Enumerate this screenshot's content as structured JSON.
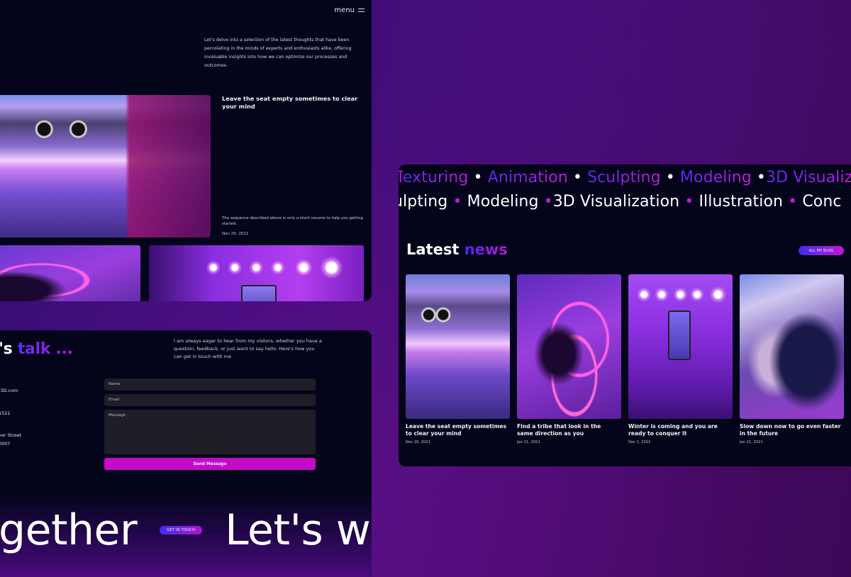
{
  "blog_page": {
    "menu_label": "menu",
    "intro": "Let's delve into a selection of the latest thoughts that have been percolating in the minds of experts and enthusiasts alike, offering invaluable insights into how we can optimize our processes and outcomes.",
    "featured": {
      "title": "Leave the seat empty sometimes to clear your mind",
      "description": "The sequence described above is only a short resume to help you getting started.",
      "date": "Nov 20, 2021",
      "image": "neon-tunnel-photo"
    },
    "thumbnails": [
      "neon-wall-photo",
      "concert-phone-photo"
    ]
  },
  "contact_page": {
    "heading_plain": "t's",
    "heading_accent": "talk ...",
    "intro": "I am always eager to hear from my visitors, whether you have a question, feedback, or just want to say hello. Here's how you can get in touch with me",
    "info": {
      "email": "-3D.com",
      "phone": "1521",
      "address_line1": "ver Street",
      "address_line2": "0007"
    },
    "form": {
      "name_placeholder": "Name",
      "email_placeholder": "Email",
      "message_placeholder": "Message",
      "send_label": "Send Message"
    },
    "marquee": {
      "left_text": "gether",
      "button_label": "GET IN TOUCH",
      "right_text": "Let's w"
    }
  },
  "news_section": {
    "skills_row1": [
      "exturing",
      "Animation",
      "Sculpting",
      "Modeling",
      "3D Visualiz"
    ],
    "skills_row2": [
      "ulpting",
      "Modeling",
      "3D Visualization",
      "Illustration",
      "Conc"
    ],
    "skills_row1_prefix": "T",
    "separator": "•",
    "heading_plain": "Latest",
    "heading_accent": "news",
    "all_blog_label": "ALL MY BLOG",
    "cards": [
      {
        "title": "Leave the seat empty sometimes to clear your mind",
        "date": "Nov 20, 2021",
        "image": "neon-tunnel-photo"
      },
      {
        "title": "Find a tribe that look in the same direction as you",
        "date": "Jan 21, 2021",
        "image": "neon-wall-photo"
      },
      {
        "title": "Winter is coming and you are ready to conquer it",
        "date": "Dec 1, 2021",
        "image": "concert-phone-photo"
      },
      {
        "title": "Slow down now to go even faster in the future",
        "date": "Jan 21, 2021",
        "image": "couple-dance-photo"
      }
    ]
  },
  "colors": {
    "panel_bg": "#04041a",
    "accent_blue": "#4a2cf0",
    "accent_magenta": "#c30bc8",
    "field_bg": "#1e1d28"
  }
}
